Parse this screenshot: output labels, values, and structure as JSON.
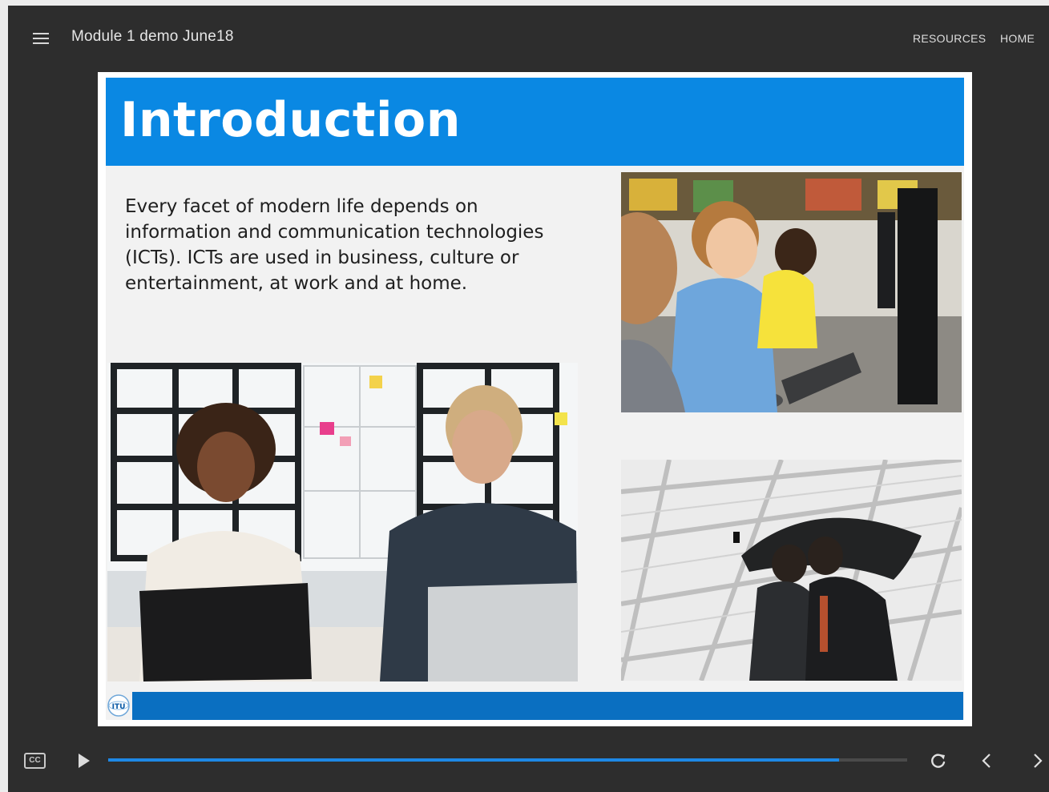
{
  "header": {
    "course_title": "Module 1 demo June18",
    "nav": {
      "resources": "RESOURCES",
      "home": "HOME"
    }
  },
  "slide": {
    "title": "Introduction",
    "body": "Every facet of modern life depends on information and communication technologies (ICTs). ICTs are used in business, culture or entertainment, at work and at home.",
    "logo_text": "ITU",
    "colors": {
      "title_bar": "#0a88e3",
      "footer_bar": "#0a6fc1"
    },
    "images": [
      "office-colleagues-photo",
      "children-computers-photo",
      "umbrella-selfie-photo"
    ]
  },
  "controls": {
    "cc_label": "CC",
    "progress": 0.915,
    "icons": [
      "closed-captions-icon",
      "play-icon",
      "replay-icon",
      "chevron-left-icon",
      "chevron-right-icon"
    ],
    "accent_color": "#1e88e5"
  }
}
